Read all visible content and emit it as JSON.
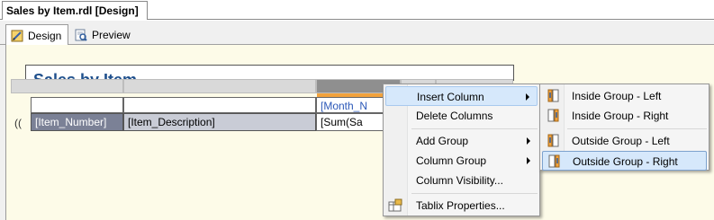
{
  "document_tab": {
    "title": "Sales by Item.rdl [Design]"
  },
  "view_tabs": [
    {
      "label": "Design",
      "icon": "design-icon",
      "active": true
    },
    {
      "label": "Preview",
      "icon": "preview-icon",
      "active": false
    }
  ],
  "report": {
    "title": "Sales by Item",
    "column_group_header": "[Month_N",
    "detail_cells": [
      "[Item_Number]",
      "[Item_Description]",
      "[Sum(Sa"
    ],
    "row_handle": "(("
  },
  "context_menu": {
    "items": [
      {
        "label": "Insert Column",
        "has_submenu": true,
        "highlighted": true
      },
      {
        "label": "Delete Columns",
        "has_submenu": false
      },
      {
        "label": "Add Group",
        "has_submenu": true
      },
      {
        "label": "Column Group",
        "has_submenu": true
      },
      {
        "label": "Column Visibility...",
        "has_submenu": false
      },
      {
        "label": "Tablix Properties...",
        "has_submenu": false,
        "icon": "tablix-properties-icon"
      }
    ]
  },
  "submenu": {
    "items": [
      {
        "label": "Inside Group - Left",
        "icon": "insert-column-left-icon"
      },
      {
        "label": "Inside Group - Right",
        "icon": "insert-column-right-icon"
      },
      {
        "label": "Outside Group - Left",
        "icon": "insert-column-left-icon"
      },
      {
        "label": "Outside Group - Right",
        "icon": "insert-column-right-icon",
        "highlighted": true
      }
    ]
  },
  "colors": {
    "accent_orange": "#f2a23c",
    "menu_highlight": "#d6e8fb",
    "design_surface": "#fdfbe8",
    "bound_cell": "#7b8196"
  }
}
